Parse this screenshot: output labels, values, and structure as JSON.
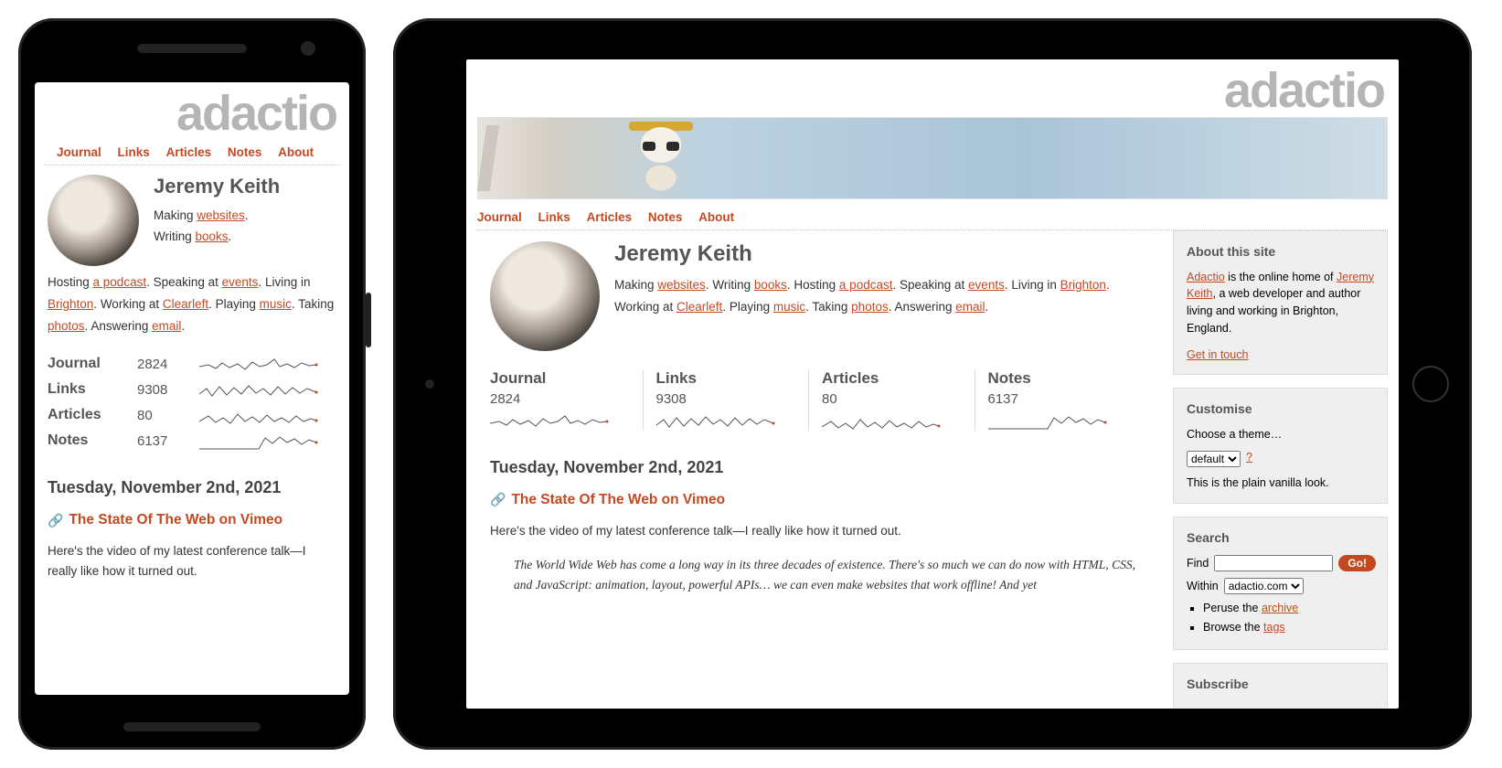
{
  "brand": "adactio",
  "nav": [
    "Journal",
    "Links",
    "Articles",
    "Notes",
    "About"
  ],
  "author": "Jeremy Keith",
  "bio": {
    "making": "Making ",
    "making_link": "websites",
    "writing": "Writing ",
    "writing_link": "books",
    "hosting": "Hosting ",
    "hosting_link": "a podcast",
    "speaking": "Speaking at ",
    "speaking_link": "events",
    "living": "Living in ",
    "living_link": "Brighton",
    "working": "Working at ",
    "working_link": "Clearleft",
    "playing": "Playing ",
    "playing_link": "music",
    "taking": "Taking ",
    "taking_link": "photos",
    "answering": "Answering ",
    "answering_link": "email"
  },
  "stats": [
    {
      "label": "Journal",
      "count": "2824"
    },
    {
      "label": "Links",
      "count": "9308"
    },
    {
      "label": "Articles",
      "count": "80"
    },
    {
      "label": "Notes",
      "count": "6137"
    }
  ],
  "date": "Tuesday, November 2nd, 2021",
  "post": {
    "title": "The State Of The Web on Vimeo",
    "excerpt": "Here's the video of my latest conference talk—I really like how it turned out.",
    "quote": "The World Wide Web has come a long way in its three decades of existence. There's so much we can do now with HTML, CSS, and JavaScript: animation, layout, powerful APIs… we can even make websites that work offline! And yet"
  },
  "sidebar": {
    "about": {
      "heading": "About this site",
      "adactio": "Adactio",
      "mid1": " is the online home of ",
      "name": "Jeremy Keith",
      "mid2": ", a web developer and author living and working in Brighton, England.",
      "contact": "Get in touch"
    },
    "customise": {
      "heading": "Customise",
      "choose": "Choose a theme…",
      "selected": "default",
      "help": "?",
      "desc": "This is the plain vanilla look."
    },
    "search": {
      "heading": "Search",
      "find": "Find",
      "go": "Go!",
      "within": "Within",
      "within_selected": "adactio.com",
      "peruse_pre": "Peruse the ",
      "peruse_link": "archive",
      "browse_pre": "Browse the ",
      "browse_link": "tags"
    },
    "subscribe": {
      "heading": "Subscribe"
    }
  }
}
